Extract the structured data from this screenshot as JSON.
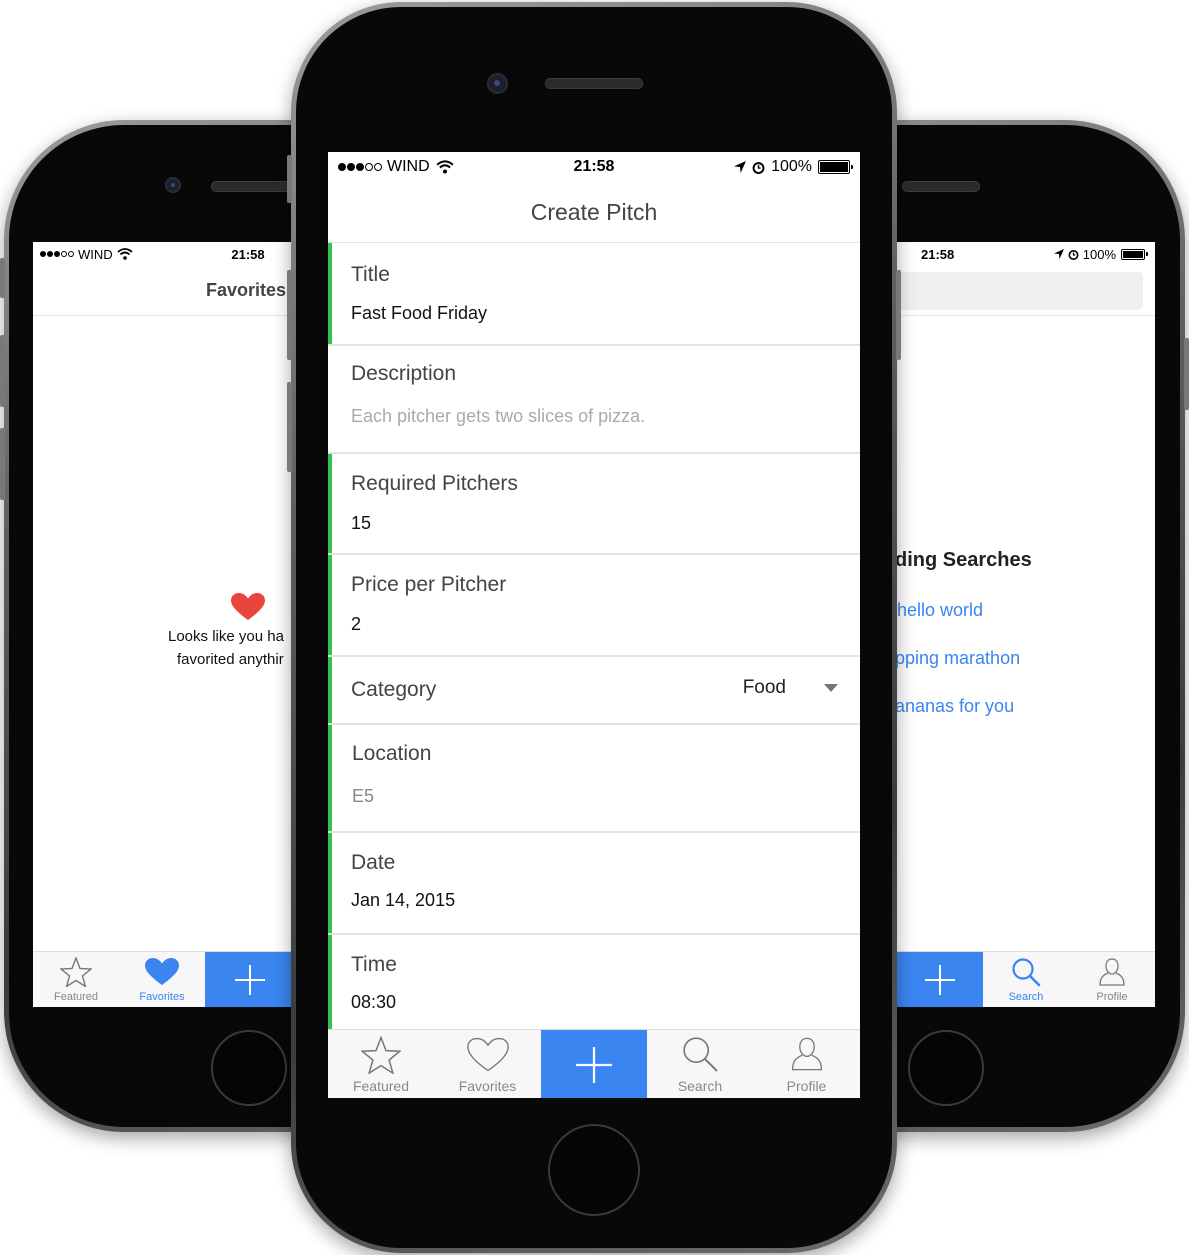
{
  "center": {
    "status": {
      "carrier": "WIND",
      "time": "21:58",
      "battery": "100%"
    },
    "title": "Create Pitch",
    "fields": [
      {
        "label": "Title",
        "value": "Fast Food Friday",
        "required": true
      },
      {
        "label": "Description",
        "value": "Each pitcher gets two slices of pizza.",
        "required": false
      },
      {
        "label": "Required Pitchers",
        "value": "15",
        "required": true
      },
      {
        "label": "Price per Pitcher",
        "value": "2",
        "required": true
      },
      {
        "label": "Category",
        "value": "Food",
        "required": true
      },
      {
        "label": "Location",
        "value": "E5",
        "required": true
      },
      {
        "label": "Date",
        "value": "Jan 14, 2015",
        "required": true
      },
      {
        "label": "Time",
        "value": "08:30",
        "required": true
      }
    ],
    "tabs": [
      "Featured",
      "Favorites",
      "",
      "Search",
      "Profile"
    ]
  },
  "left": {
    "status": {
      "carrier": "WIND",
      "time": "21:58"
    },
    "title": "Favorites",
    "empty_line1": "Looks like you ha",
    "empty_line2": "favorited anythir",
    "tabs": [
      "Featured",
      "Favorites"
    ]
  },
  "right": {
    "status": {
      "time": "21:58",
      "battery": "100%"
    },
    "section_title": "ding Searches",
    "links": [
      "hello world",
      "pping marathon",
      "ananas for you"
    ],
    "tabs": [
      "Search",
      "Profile"
    ]
  },
  "colors": {
    "accent": "#3a85f0",
    "required_bar": "#33c24d",
    "heart": "#e8453c"
  }
}
